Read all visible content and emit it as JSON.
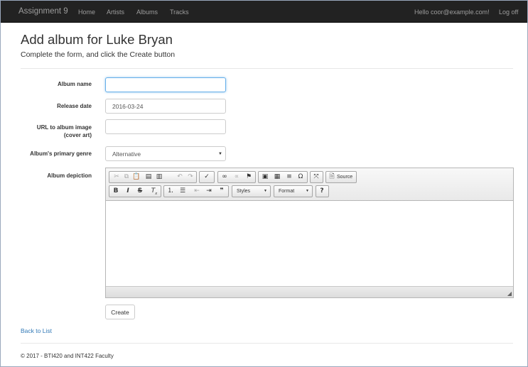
{
  "nav": {
    "brand": "Assignment 9",
    "links": [
      "Home",
      "Artists",
      "Albums",
      "Tracks"
    ],
    "greeting": "Hello coor@example.com!",
    "logoff": "Log off"
  },
  "page": {
    "title": "Add album for Luke Bryan",
    "subtitle": "Complete the form, and click the Create button"
  },
  "form": {
    "album_name_label": "Album name",
    "album_name_value": "",
    "release_date_label": "Release date",
    "release_date_value": "2016-03-24",
    "url_label_line1": "URL to album image",
    "url_label_line2": "(cover art)",
    "url_value": "",
    "genre_label": "Album's primary genre",
    "genre_selected": "Alternative",
    "depiction_label": "Album depiction",
    "create_button": "Create"
  },
  "editor": {
    "source_label": "Source",
    "styles_label": "Styles",
    "format_label": "Format",
    "icons": [
      "cut-icon",
      "copy-icon",
      "paste-icon",
      "paste-text-icon",
      "paste-word-icon",
      "undo-icon",
      "redo-icon",
      "spellcheck-icon",
      "link-icon",
      "unlink-icon",
      "anchor-icon",
      "image-icon",
      "table-icon",
      "horizontal-line-icon",
      "special-char-icon",
      "maximize-icon",
      "source-icon",
      "bold-icon",
      "italic-icon",
      "strike-icon",
      "remove-format-icon",
      "numbered-list-icon",
      "bulleted-list-icon",
      "outdent-icon",
      "indent-icon",
      "blockquote-icon",
      "help-icon"
    ]
  },
  "links": {
    "back": "Back to List"
  },
  "footer": {
    "text": "© 2017 - BTI420 and INT422 Faculty"
  }
}
